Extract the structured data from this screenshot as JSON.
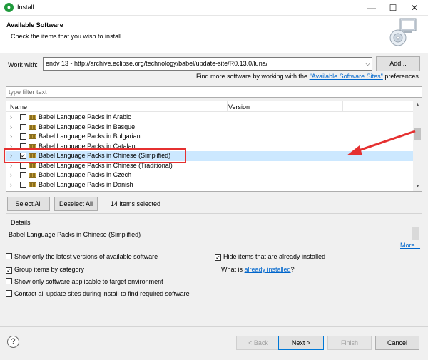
{
  "window": {
    "title": "Install",
    "icons": {
      "app": "eclipse-installer-icon",
      "minimize": "minimize-icon",
      "maximize": "maximize-icon",
      "close": "close-icon"
    }
  },
  "header": {
    "title": "Available Software",
    "description": "Check the items that you wish to install."
  },
  "work_with": {
    "label": "Work with:",
    "value": "endv 13 - http://archive.eclipse.org/technology/babel/update-site/R0.13.0/luna/",
    "add_label": "Add...",
    "find_more_prefix": "Find more software by working with the ",
    "find_more_link": "\"Available Software Sites\"",
    "find_more_suffix": " preferences."
  },
  "filter": {
    "placeholder": "type filter text"
  },
  "tree": {
    "columns": [
      "Name",
      "Version"
    ],
    "rows": [
      {
        "label": "Babel Language Packs in Arabic",
        "checked": false
      },
      {
        "label": "Babel Language Packs in Basque",
        "checked": false
      },
      {
        "label": "Babel Language Packs in Bulgarian",
        "checked": false
      },
      {
        "label": "Babel Language Packs in Catalan",
        "checked": false
      },
      {
        "label": "Babel Language Packs in Chinese (Simplified)",
        "checked": true,
        "selected": true
      },
      {
        "label": "Babel Language Packs in Chinese (Traditional)",
        "checked": false
      },
      {
        "label": "Babel Language Packs in Czech",
        "checked": false
      },
      {
        "label": "Babel Language Packs in Danish",
        "checked": false
      }
    ]
  },
  "selection": {
    "select_all": "Select All",
    "deselect_all": "Deselect All",
    "count_text": "14 items selected"
  },
  "details": {
    "label": "Details",
    "text": "Babel Language Packs in Chinese (Simplified)",
    "more": "More..."
  },
  "options": {
    "latest": {
      "label": "Show only the latest versions of available software",
      "checked": false
    },
    "group": {
      "label": "Group items by category",
      "checked": true
    },
    "applicable": {
      "label": "Show only software applicable to target environment",
      "checked": false
    },
    "contact": {
      "label": "Contact all update sites during install to find required software",
      "checked": false
    },
    "hide": {
      "label": "Hide items that are already installed",
      "checked": true
    },
    "whatis_prefix": "What is ",
    "whatis_link": "already installed",
    "whatis_suffix": "?"
  },
  "footer": {
    "help": "?",
    "back": "< Back",
    "next": "Next >",
    "finish": "Finish",
    "cancel": "Cancel"
  },
  "colors": {
    "accent_annotation": "#e53030",
    "selection": "#cce8ff",
    "link": "#0066cc"
  }
}
